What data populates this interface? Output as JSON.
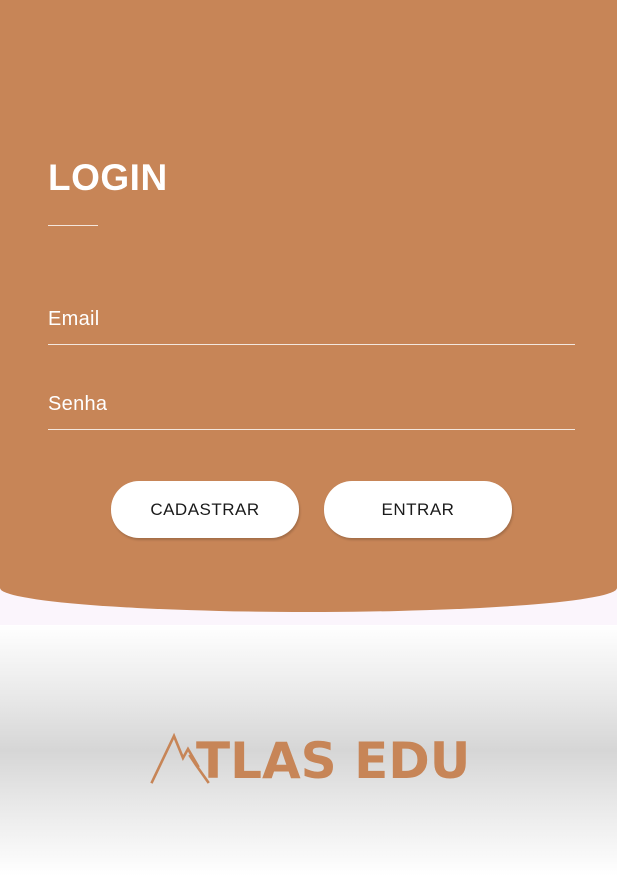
{
  "login": {
    "title": "LOGIN",
    "email_placeholder": "Email",
    "senha_placeholder": "Senha",
    "cadastrar_label": "CADASTRAR",
    "entrar_label": "ENTRAR"
  },
  "logo": {
    "icon": "mountain-icon",
    "text": "TLAS EDU"
  },
  "colors": {
    "accent": "#c78557",
    "button_bg": "#ffffff",
    "text_on_accent": "#ffffff"
  }
}
